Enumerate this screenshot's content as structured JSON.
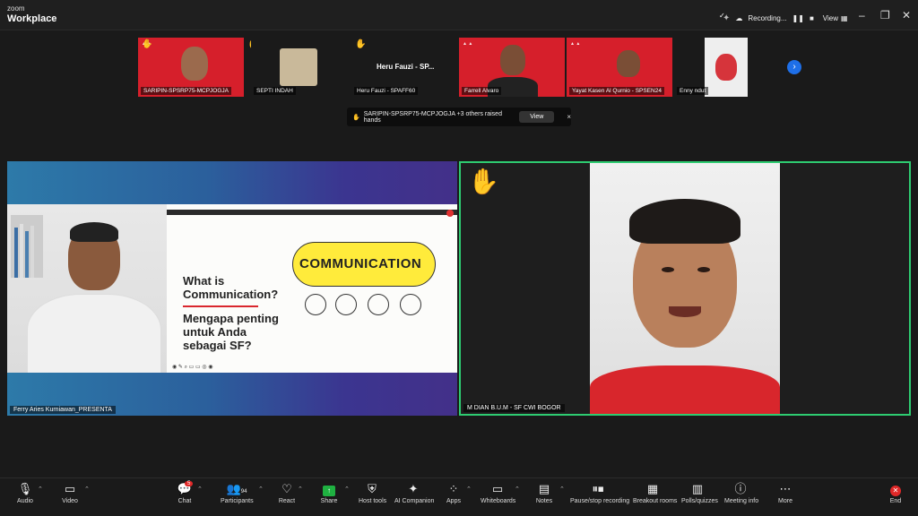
{
  "app": {
    "brand_top": "zoom",
    "brand_bottom": "Workplace"
  },
  "titlebar": {
    "recording_label": "Recording...",
    "pause_icon": "pause-icon",
    "stop_icon": "stop-icon",
    "view_label": "View",
    "controls": [
      "–",
      "❐",
      "✕"
    ]
  },
  "participants_strip": [
    {
      "name": "SARIPIN-SPSRP75-MCPJOGJA",
      "style": "red",
      "hand": true
    },
    {
      "name": "SEPTI INDAH",
      "style": "photo",
      "hand": false
    },
    {
      "name": "Heru Fauzi - SPAFF60",
      "display_name": "Heru Fauzi - SP...",
      "style": "name",
      "hand": true
    },
    {
      "name": "Farrell Alvaro",
      "style": "red",
      "hand": false
    },
    {
      "name": "Yayat Kasen Al Qurnio - SPSEN24",
      "style": "red",
      "hand": false
    },
    {
      "name": "Enny ndut",
      "style": "photo",
      "hand": false
    }
  ],
  "raised_hands": {
    "text": "SARIPIN-SPSRP75-MCPJOGJA +3 others raised hands",
    "view_label": "View",
    "close": "×"
  },
  "main": {
    "left_label": "Ferry Aries Kurniawan_PRESENTA",
    "right_label": "M DIAN B.U.M - SF CWI BOGOR",
    "slide": {
      "title_line1": "What is",
      "title_line2": "Communication?",
      "sub_line1": "Mengapa penting",
      "sub_line2": "untuk Anda",
      "sub_line3": "sebagai SF?",
      "cloud_text": "COMMUNICATION"
    }
  },
  "toolbar": {
    "audio": "Audio",
    "video": "Video",
    "chat": "Chat",
    "chat_badge": "5",
    "participants": "Participants",
    "participants_count": "94",
    "react": "React",
    "share": "Share",
    "host_tools": "Host tools",
    "ai_companion": "AI Companion",
    "apps": "Apps",
    "whiteboards": "Whiteboards",
    "notes": "Notes",
    "pause_stop": "Pause/stop recording",
    "breakout": "Breakout rooms",
    "polls": "Polls/quizzes",
    "meeting_info": "Meeting info",
    "more": "More",
    "end": "End"
  },
  "colors": {
    "accent_green": "#2ecc71",
    "end_red": "#e02828",
    "brand_red": "#d61f2b"
  }
}
